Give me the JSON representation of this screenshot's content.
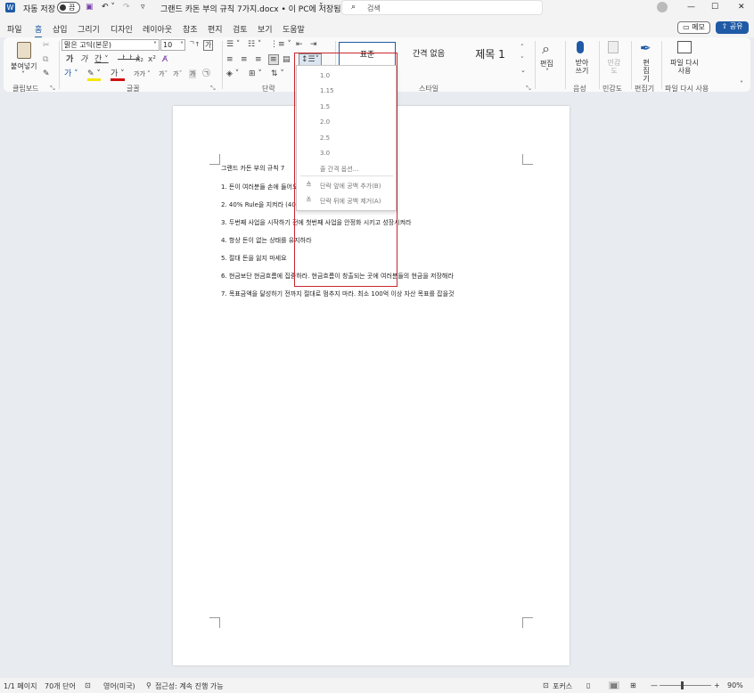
{
  "titlebar": {
    "autosave_label": "자동 저장",
    "autosave_state": "끔",
    "doc_title": "그랜드 카돈 부의 규칙 7가지.docx • 이 PC에 저장됨",
    "search_placeholder": "검색"
  },
  "menu": {
    "tabs": [
      "파일",
      "홈",
      "삽입",
      "그리기",
      "디자인",
      "레이아웃",
      "참조",
      "편지",
      "검토",
      "보기",
      "도움말"
    ],
    "memo_label": "메모",
    "share_label": "공유"
  },
  "ribbon": {
    "clipboard": {
      "paste_label": "붙여넣기",
      "group_label": "클립보드"
    },
    "font": {
      "font_name": "맑은 고딕(본문)",
      "font_size": "10",
      "group_label": "글꼴"
    },
    "paragraph": {
      "group_label": "단락"
    },
    "styles": {
      "items": [
        "표준",
        "간격 없음",
        "제목 1"
      ],
      "group_label": "스타일"
    },
    "edit": {
      "label": "편집"
    },
    "voice": {
      "dictate_label": "받아쓰기",
      "group_label": "음성"
    },
    "sensitivity": {
      "label": "민감도",
      "group_label": "민감도"
    },
    "editor": {
      "label": "편집기",
      "group_label": "편집기"
    },
    "reuse": {
      "label": "파일 다시 사용",
      "group_label": "파일 다시 사용"
    }
  },
  "line_spacing_menu": {
    "values": [
      "1.0",
      "1.15",
      "1.5",
      "2.0",
      "2.5",
      "3.0"
    ],
    "options_label": "줄 간격 옵션...",
    "add_before": "단락 앞에 공백 추가(B)",
    "remove_after": "단락 뒤에 공백 제거(A)"
  },
  "document": {
    "lines": [
      "그랜드 카돈 부의 규칙 7",
      "1. 돈이 여러분들 손에 들어오면 편하게 두면 안된다",
      "2. 40% Rule을 지켜라 (40%는 세금, 60%로 생활)",
      "3. 두번째 사업을 시작하기 전에 첫번째 사업을 안정화 시키고 성장시켜라",
      "4. 항상 돈이 없는 상태를 유지하라",
      "5. 절대 돈을 잃지 마세요",
      "6. 현금보단 현금흐름에 집중하라. 현금흐름이 창출되는 곳에 여러분들의 현금을 저장해라",
      "7. 목표금액을 달성하기 전까지 절대로 멈추지 마라. 최소 100억 이상 자산 목표를 잡을것"
    ]
  },
  "statusbar": {
    "page": "1/1 페이지",
    "words": "70개 단어",
    "language": "영어(미국)",
    "accessibility": "접근성: 계속 진행 가능",
    "focus": "포커스",
    "zoom": "90%"
  },
  "colors": {
    "accent": "#1f5aa6",
    "highlight_box": "#c8272e"
  }
}
